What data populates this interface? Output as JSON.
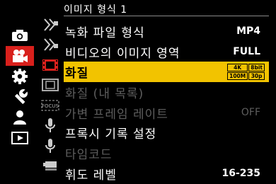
{
  "header": {
    "title": "이미지 형식 1"
  },
  "left_menu": [
    {
      "name": "camera-icon",
      "selected": false
    },
    {
      "name": "video-camera-icon",
      "selected": true
    },
    {
      "name": "gear-icon",
      "selected": false
    },
    {
      "name": "wrench-icon",
      "selected": false
    },
    {
      "name": "person-icon",
      "selected": false
    },
    {
      "name": "play-icon",
      "selected": false
    }
  ],
  "sub_icons": [
    "rec-quality-icon-a",
    "rec-quality-icon-b",
    "film-frame-icon",
    "film-frame-outline-icon",
    "focus-icon",
    "microphone-icon",
    "microphone-icon-2",
    "tripod-icon"
  ],
  "menu": {
    "items": [
      {
        "label": "녹화 파일 형식",
        "value": "MP4",
        "state": "normal"
      },
      {
        "label": "비디오의 이미지 영역",
        "value": "FULL",
        "state": "normal"
      },
      {
        "label": "화질",
        "value": "",
        "state": "selected",
        "badge": {
          "res": "4K",
          "bit": "8bit",
          "rate": "100M",
          "fps": "30p"
        }
      },
      {
        "label": "화질 (내 목록)",
        "value": "",
        "state": "dim"
      },
      {
        "label": "가변 프레임 레이트",
        "value": "OFF",
        "state": "dim"
      },
      {
        "label": "프록시 기록 설정",
        "value": "",
        "state": "normal"
      },
      {
        "label": "타임코드",
        "value": "",
        "state": "dim"
      },
      {
        "label": "휘도 레벨",
        "value": "16-235",
        "state": "normal"
      }
    ]
  },
  "colors": {
    "accent": "#f2c300",
    "selected_tab": "#d8201c",
    "disabled": "#5e5e5e"
  }
}
